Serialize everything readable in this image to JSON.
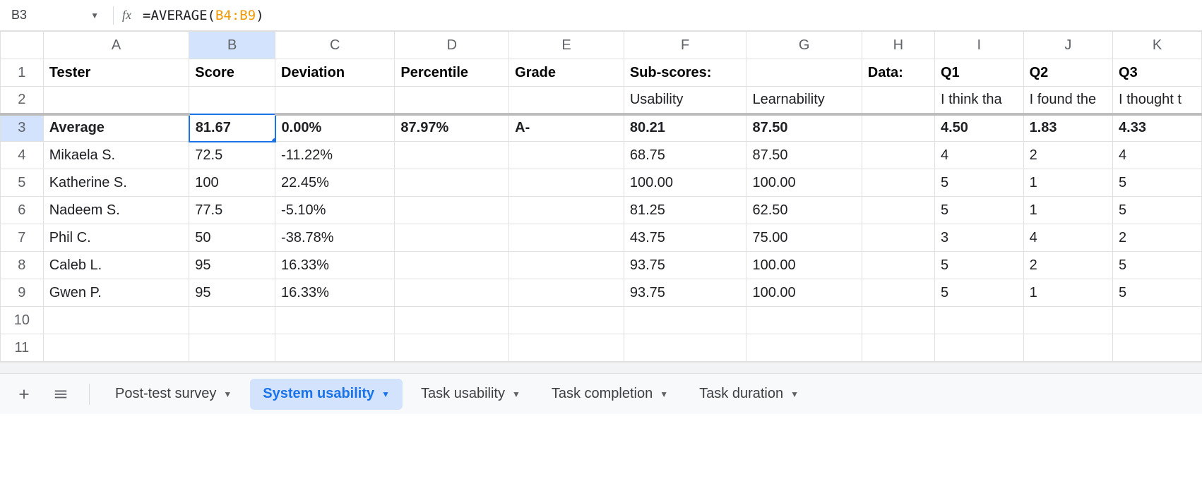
{
  "formula_bar": {
    "cell_ref": "B3",
    "fx_label": "fx",
    "formula_eq": "=",
    "formula_fn": "AVERAGE",
    "formula_open": "(",
    "formula_range": "B4:B9",
    "formula_close": ")"
  },
  "columns": [
    "A",
    "B",
    "C",
    "D",
    "E",
    "F",
    "G",
    "H",
    "I",
    "J",
    "K"
  ],
  "row_numbers": [
    "1",
    "2",
    "3",
    "4",
    "5",
    "6",
    "7",
    "8",
    "9",
    "10",
    "11"
  ],
  "header_row": {
    "A": "Tester",
    "B": "Score",
    "C": "Deviation",
    "D": "Percentile",
    "E": "Grade",
    "F": "Sub-scores:",
    "G": "",
    "H": "Data:",
    "I": "Q1",
    "J": "Q2",
    "K": "Q3"
  },
  "row2": {
    "A": "",
    "B": "",
    "C": "",
    "D": "",
    "E": "",
    "F": "Usability",
    "G": "Learnability",
    "H": "",
    "I": "I think tha",
    "J": "I found the",
    "K": "I thought t"
  },
  "avg_row": {
    "A": "Average",
    "B": "81.67",
    "C": "0.00%",
    "D": "87.97%",
    "E": "A-",
    "F": "80.21",
    "G": "87.50",
    "H": "",
    "I": "4.50",
    "J": "1.83",
    "K": "4.33"
  },
  "data_rows": [
    {
      "A": "Mikaela S.",
      "B": "72.5",
      "C": "-11.22%",
      "D": "",
      "E": "",
      "F": "68.75",
      "G": "87.50",
      "H": "",
      "I": "4",
      "J": "2",
      "K": "4"
    },
    {
      "A": "Katherine S.",
      "B": "100",
      "C": "22.45%",
      "D": "",
      "E": "",
      "F": "100.00",
      "G": "100.00",
      "H": "",
      "I": "5",
      "J": "1",
      "K": "5"
    },
    {
      "A": "Nadeem S.",
      "B": "77.5",
      "C": "-5.10%",
      "D": "",
      "E": "",
      "F": "81.25",
      "G": "62.50",
      "H": "",
      "I": "5",
      "J": "1",
      "K": "5"
    },
    {
      "A": "Phil C.",
      "B": "50",
      "C": "-38.78%",
      "D": "",
      "E": "",
      "F": "43.75",
      "G": "75.00",
      "H": "",
      "I": "3",
      "J": "4",
      "K": "2"
    },
    {
      "A": "Caleb L.",
      "B": "95",
      "C": "16.33%",
      "D": "",
      "E": "",
      "F": "93.75",
      "G": "100.00",
      "H": "",
      "I": "5",
      "J": "2",
      "K": "5"
    },
    {
      "A": "Gwen P.",
      "B": "95",
      "C": "16.33%",
      "D": "",
      "E": "",
      "F": "93.75",
      "G": "100.00",
      "H": "",
      "I": "5",
      "J": "1",
      "K": "5"
    }
  ],
  "tabs": {
    "items": [
      {
        "label": "Post-test survey",
        "active": false
      },
      {
        "label": "System usability",
        "active": true
      },
      {
        "label": "Task usability",
        "active": false
      },
      {
        "label": "Task completion",
        "active": false
      },
      {
        "label": "Task duration",
        "active": false
      }
    ]
  }
}
